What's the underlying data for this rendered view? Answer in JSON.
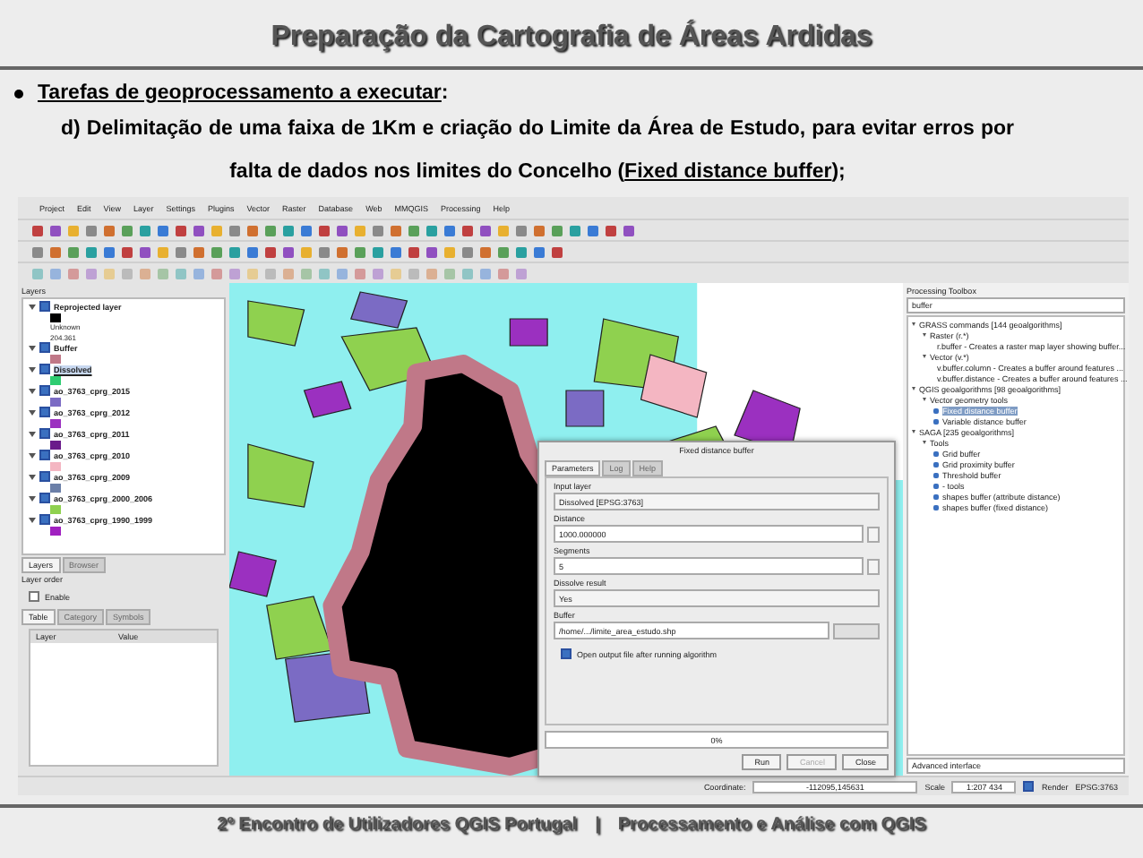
{
  "slide": {
    "title": "Preparação da Cartografia de Áreas Ardidas",
    "bullet": "Tarefas de geoprocessamento a executar",
    "bullet_suffix": ":",
    "paragraph": "d) Delimitação de uma faixa de 1Km e criação do Limite da Área de Estudo, para evitar erros por falta de dados nos limites do Concelho (**Fixed distance buffer**);",
    "footer_left": "2º Encontro de Utilizadores QGIS Portugal",
    "footer_separator": "|",
    "footer_right": "Processamento e Análise com QGIS"
  },
  "qgis": {
    "menu": [
      "Project",
      "Edit",
      "View",
      "Layer",
      "Settings",
      "Plugins",
      "Vector",
      "Raster",
      "Database",
      "Web",
      "MMQGIS",
      "Processing",
      "Help"
    ],
    "layers_title": "Layers",
    "layers": [
      {
        "name": "Reprojected layer",
        "checked": true,
        "selected": false,
        "color": "#000000",
        "legend": [
          "Unknown",
          "204.361"
        ]
      },
      {
        "name": "Buffer",
        "checked": true,
        "selected": false,
        "color": "#c07888"
      },
      {
        "name": "Dissolved",
        "checked": true,
        "selected": true,
        "color": "#2ecc71"
      },
      {
        "name": "ao_3763_cprg_2015",
        "checked": true,
        "selected": false,
        "color": "#7b6bc4"
      },
      {
        "name": "ao_3763_cprg_2012",
        "checked": true,
        "selected": false,
        "color": "#9b30c0"
      },
      {
        "name": "ao_3763_cprg_2011",
        "checked": true,
        "selected": false,
        "color": "#6a1b8a"
      },
      {
        "name": "ao_3763_cprg_2010",
        "checked": true,
        "selected": false,
        "color": "#f4b6c2"
      },
      {
        "name": "ao_3763_cprg_2009",
        "checked": true,
        "selected": false,
        "color": "#6b7fa8"
      },
      {
        "name": "ao_3763_cprg_2000_2006",
        "checked": true,
        "selected": false,
        "color": "#8fd14f"
      },
      {
        "name": "ao_3763_cprg_1990_1999",
        "checked": true,
        "selected": false,
        "color": "#a020c0"
      }
    ],
    "panel_tabs": [
      {
        "label": "Layers",
        "selected": true
      },
      {
        "label": "Browser",
        "selected": false
      }
    ],
    "order_panel": {
      "title": "Layer order",
      "enable": {
        "label": "Enable",
        "checked": false
      },
      "tabs": [
        {
          "label": "Table",
          "selected": true
        },
        {
          "label": "Category",
          "selected": false
        },
        {
          "label": "Symbols",
          "selected": false
        }
      ],
      "columns": [
        "Layer",
        "Value"
      ]
    },
    "toolbox": {
      "title": "Processing Toolbox",
      "search": "buffer",
      "tree": [
        {
          "label": "GRASS commands [144 geoalgorithms]",
          "expanded": true,
          "children": [
            {
              "label": "Raster (r.*)",
              "expanded": true,
              "children": [
                {
                  "label": "r.buffer - Creates a raster map layer showing buffer...",
                  "selected": false
                }
              ]
            },
            {
              "label": "Vector (v.*)",
              "expanded": true,
              "children": [
                {
                  "label": "v.buffer.column - Creates a buffer around features ...",
                  "selected": false
                },
                {
                  "label": "v.buffer.distance - Creates a buffer around features ...",
                  "selected": false
                }
              ]
            }
          ]
        },
        {
          "label": "QGIS geoalgorithms [98 geoalgorithms]",
          "expanded": true,
          "children": [
            {
              "label": "Vector geometry tools",
              "expanded": true,
              "children": [
                {
                  "label": "Fixed distance buffer",
                  "selected": true
                },
                {
                  "label": "Variable distance buffer",
                  "selected": false
                }
              ]
            }
          ]
        },
        {
          "label": "SAGA [235 geoalgorithms]",
          "expanded": true,
          "children": [
            {
              "label": "Tools",
              "expanded": true,
              "children": [
                {
                  "label": "Grid buffer",
                  "selected": false
                },
                {
                  "label": "Grid proximity buffer",
                  "selected": false
                },
                {
                  "label": "Threshold buffer",
                  "selected": false
                },
                {
                  "label": "- tools",
                  "selected": false
                },
                {
                  "label": "shapes buffer (attribute distance)",
                  "selected": false
                },
                {
                  "label": "shapes buffer (fixed distance)",
                  "selected": false
                }
              ]
            }
          ]
        }
      ],
      "mode": "Advanced interface"
    },
    "dialog": {
      "title": "Fixed distance buffer",
      "tabs": [
        {
          "label": "Parameters",
          "selected": true
        },
        {
          "label": "Log",
          "selected": false
        },
        {
          "label": "Help",
          "selected": false
        }
      ],
      "fields": [
        {
          "kind": "combo",
          "label": "Input layer",
          "value": "Dissolved [EPSG:3763]"
        },
        {
          "kind": "number",
          "label": "Distance",
          "value": "1000.000000"
        },
        {
          "kind": "number",
          "label": "Segments",
          "value": "5"
        },
        {
          "kind": "combo",
          "label": "Dissolve result",
          "value": "Yes"
        },
        {
          "kind": "file",
          "label": "Buffer",
          "value": "/home/.../limite_area_estudo.shp"
        }
      ],
      "open_output": {
        "label": "Open output file after running algorithm",
        "checked": true
      },
      "progress": {
        "level": 0,
        "reading": "0%"
      },
      "buttons": [
        {
          "label": "Run",
          "disabled": false
        },
        {
          "label": "Cancel",
          "disabled": true
        },
        {
          "label": "Close",
          "disabled": false
        }
      ]
    },
    "status": {
      "coordinate_label": "Coordinate:",
      "coordinate": "-112095,145631",
      "scale_label": "Scale",
      "scale": "1:207 434",
      "render": {
        "label": "Render",
        "checked": true
      },
      "crs": "EPSG:3763"
    }
  }
}
